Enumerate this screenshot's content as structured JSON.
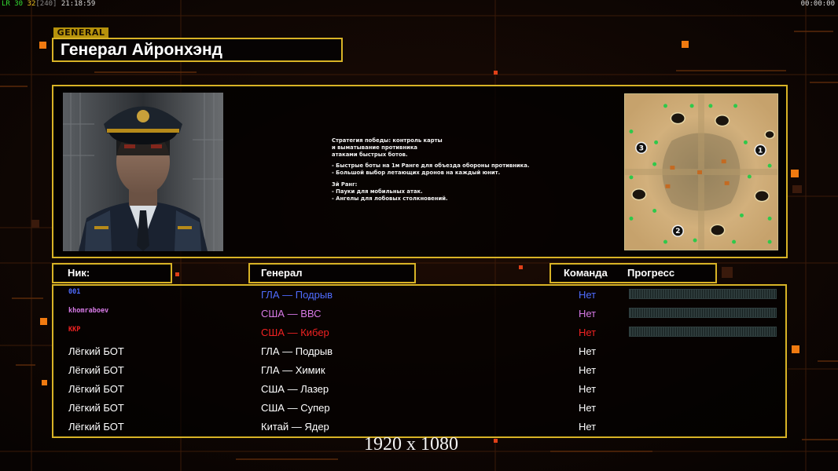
{
  "hud": {
    "fps_label": "LR",
    "fps_value": "30",
    "cpu_value": "32",
    "bracket_value": "[240]",
    "clock": "21:18:59",
    "timer": "00:00:00"
  },
  "general": {
    "tag": "GENERAL",
    "name": "Генерал Айронхэнд"
  },
  "strategy": {
    "lines": [
      "Стратегия победы: контроль карты",
      "и выматывание противника",
      "атаками быстрых ботов.",
      "",
      "- Быстрые боты на 1м Ранге для объезда обороны противника.",
      "- Большой выбор летающих дронов на каждый юнит.",
      "",
      "3й Ранг:",
      "- Пауки для мобильных атак.",
      "- Ангелы для лобовых столкновений."
    ]
  },
  "map": {
    "start_labels": [
      "3",
      "1",
      "2"
    ]
  },
  "headers": {
    "nick": "Ник:",
    "general": "Генерал",
    "team": "Команда",
    "progress": "Прогресс"
  },
  "players": [
    {
      "nick": "001",
      "general": "ГЛА — Подрыв",
      "team": "Нет",
      "color": "#4f6cff",
      "human": true,
      "progress": 0
    },
    {
      "nick": "khomraboev",
      "general": "США — ВВС",
      "team": "Нет",
      "color": "#d77ae6",
      "human": true,
      "progress": 0
    },
    {
      "nick": "KKP",
      "general": "США — Кибер",
      "team": "Нет",
      "color": "#f02222",
      "human": true,
      "progress": 0
    },
    {
      "nick": "Лёгкий БОТ",
      "general": "ГЛА — Подрыв",
      "team": "Нет",
      "color": "#ffffff",
      "human": false
    },
    {
      "nick": "Лёгкий БОТ",
      "general": "ГЛА — Химик",
      "team": "Нет",
      "color": "#ffffff",
      "human": false
    },
    {
      "nick": "Лёгкий БОТ",
      "general": "США — Лазер",
      "team": "Нет",
      "color": "#ffffff",
      "human": false
    },
    {
      "nick": "Лёгкий БОТ",
      "general": "США — Супер",
      "team": "Нет",
      "color": "#ffffff",
      "human": false
    },
    {
      "nick": "Лёгкий БОТ",
      "general": "Китай — Ядер",
      "team": "Нет",
      "color": "#ffffff",
      "human": false
    }
  ],
  "resolution_overlay": "1920 x 1080",
  "colors": {
    "frame": "#d8b326",
    "accent_orange": "#f07a10",
    "background": "#0b0503"
  }
}
